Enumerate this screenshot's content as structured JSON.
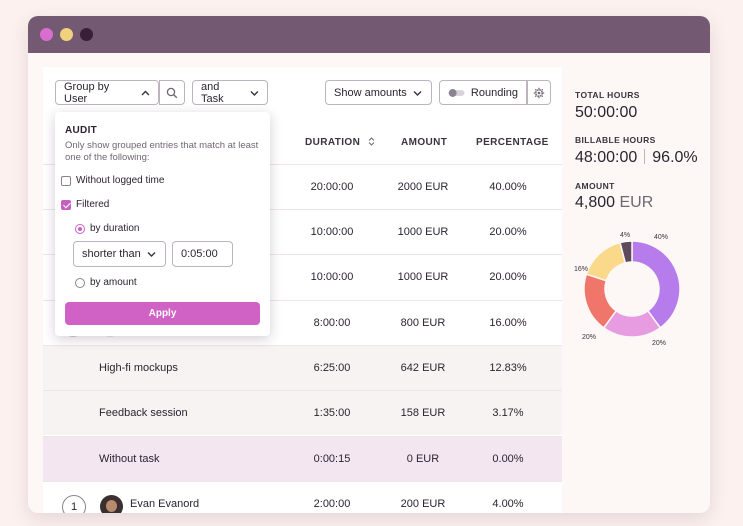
{
  "toolbar": {
    "group_by_label": "Group by User",
    "and_task_label": "and Task",
    "show_amounts_label": "Show amounts",
    "rounding_label": "Rounding"
  },
  "table": {
    "headers": {
      "duration": "DURATION",
      "amount": "AMOUNT",
      "percentage": "PERCENTAGE"
    },
    "rows": [
      {
        "task": "",
        "duration": "20:00:00",
        "amount": "2000 EUR",
        "percentage": "40.00%"
      },
      {
        "task": "",
        "duration": "10:00:00",
        "amount": "1000 EUR",
        "percentage": "20.00%"
      },
      {
        "task": "",
        "duration": "10:00:00",
        "amount": "1000 EUR",
        "percentage": "20.00%"
      },
      {
        "task": "",
        "duration": "8:00:00",
        "amount": "800 EUR",
        "percentage": "16.00%"
      },
      {
        "task": "High-fi mockups",
        "duration": "6:25:00",
        "amount": "642 EUR",
        "percentage": "12.83%"
      },
      {
        "task": "Feedback session",
        "duration": "1:35:00",
        "amount": "158 EUR",
        "percentage": "3.17%"
      },
      {
        "task": "Without task",
        "duration": "0:00:15",
        "amount": "0 EUR",
        "percentage": "0.00%"
      },
      {
        "rank": "1",
        "user": "Evan Evanord",
        "duration": "2:00:00",
        "amount": "200 EUR",
        "percentage": "4.00%"
      }
    ]
  },
  "audit": {
    "title": "AUDIT",
    "description": "Only show grouped entries that match at least one of the following:",
    "without_logged_time": "Without logged time",
    "filtered": "Filtered",
    "by_duration": "by duration",
    "comparator": "shorter than",
    "duration_value": "0:05:00",
    "by_amount": "by amount",
    "apply_label": "Apply"
  },
  "summary": {
    "total_hours_label": "TOTAL HOURS",
    "total_hours_value": "50:00:00",
    "billable_hours_label": "BILLABLE HOURS",
    "billable_hours_value": "48:00:00",
    "billable_percent": "96.0%",
    "amount_label": "AMOUNT",
    "amount_number": "4,800",
    "amount_currency": "EUR"
  },
  "chart_data": {
    "type": "pie",
    "values": [
      40,
      20,
      20,
      16,
      4
    ],
    "labels": [
      "40%",
      "20%",
      "20%",
      "16%",
      "4%"
    ],
    "colors": [
      "#b67cec",
      "#e79be0",
      "#f0766b",
      "#fbd98b",
      "#5e4a5c"
    ]
  }
}
